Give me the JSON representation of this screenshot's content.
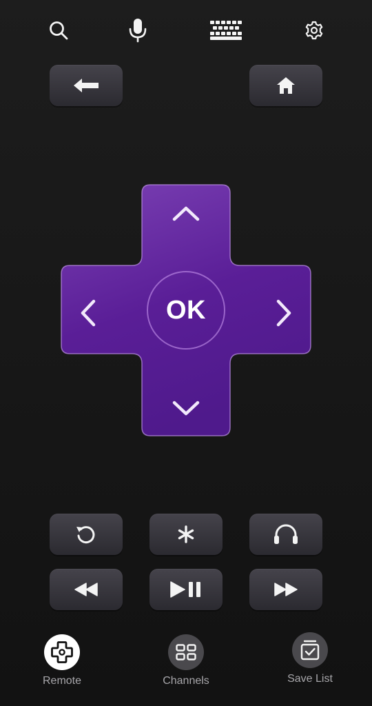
{
  "toolbar": {
    "search_icon": "search-icon",
    "voice_icon": "microphone-icon",
    "keyboard_icon": "keyboard-icon",
    "settings_icon": "gear-icon"
  },
  "dpad": {
    "ok_label": "OK",
    "up_icon": "chevron-up-icon",
    "down_icon": "chevron-down-icon",
    "left_icon": "chevron-left-icon",
    "right_icon": "chevron-right-icon",
    "colors": {
      "top": "#7b41b4",
      "bottom": "#4f1a8c",
      "edge": "#b88ce0"
    }
  },
  "buttons": {
    "back_icon": "back-arrow-icon",
    "home_icon": "home-icon",
    "replay_icon": "replay-icon",
    "options_icon": "asterisk-icon",
    "private_listening_icon": "headphones-icon",
    "rewind_icon": "rewind-icon",
    "play_pause_icon": "play-pause-icon",
    "fast_forward_icon": "fast-forward-icon"
  },
  "nav": {
    "remote_label": "Remote",
    "channels_label": "Channels",
    "save_list_label": "Save List"
  }
}
